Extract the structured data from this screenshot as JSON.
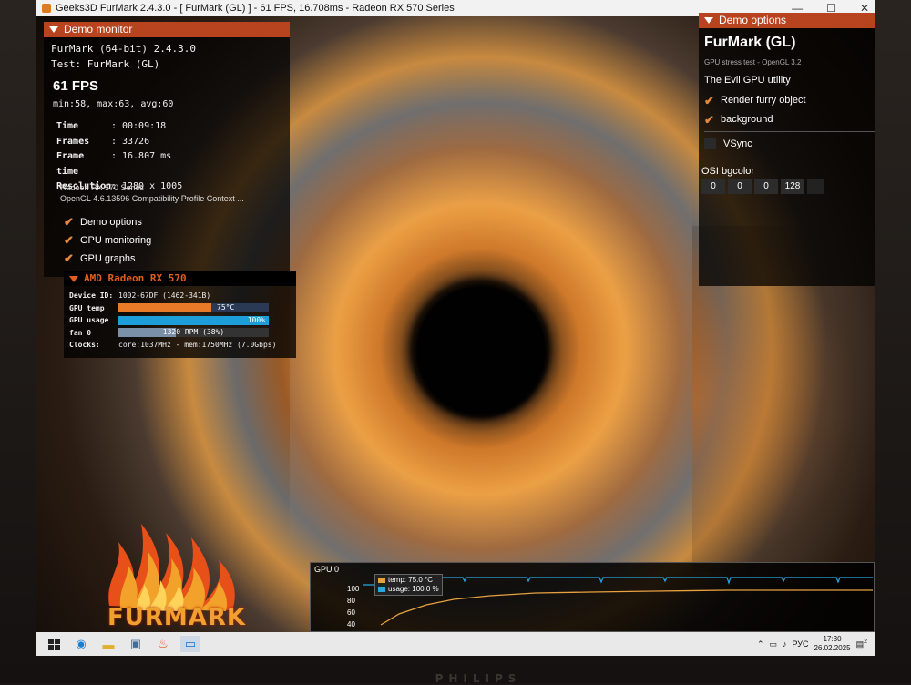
{
  "window": {
    "title": "Geeks3D FurMark 2.4.3.0 - [ FurMark (GL) ] - 61 FPS, 16.708ms - Radeon RX 570 Series",
    "min": "—",
    "max": "☐",
    "close": "✕"
  },
  "demo_monitor": {
    "header": "Demo monitor",
    "app": "FurMark (64-bit) 2.4.3.0",
    "test": "Test: FurMark (GL)",
    "fps": "61 FPS",
    "minmax": "min:58, max:63, avg:60",
    "stats": [
      {
        "key": "Time",
        "value": "00:09:18"
      },
      {
        "key": "Frames",
        "value": "33726"
      },
      {
        "key": "Frame time",
        "value": "16.807 ms"
      },
      {
        "key": "Resolution",
        "value": "1280 x 1005"
      }
    ],
    "gpu_name": "Radeon RX 570 Series",
    "gl_version": "OpenGL 4.6.13596 Compatibility Profile Context ...",
    "options": [
      "Demo options",
      "GPU monitoring",
      "GPU graphs"
    ]
  },
  "amd": {
    "header": "AMD Radeon RX 570",
    "device_id_label": "Device ID:",
    "device_id": "1002-67DF (1462-341B)",
    "temp_label": "GPU temp",
    "temp_value": "75°C",
    "temp_fraction": 0.62,
    "usage_label": "GPU usage",
    "usage_value": "100%",
    "usage_fraction": 1.0,
    "fan_label": "fan 0",
    "fan_value": "1320 RPM (38%)",
    "fan_fraction": 0.38,
    "clocks_label": "Clocks:",
    "clocks_value": "core:1037MHz - mem:1750MHz (7.0Gbps)"
  },
  "logo": {
    "text": "FURMARK"
  },
  "demo_options": {
    "header": "Demo options",
    "title": "FurMark (GL)",
    "subtitle": "GPU stress test - OpenGL 3.2",
    "evil": "The Evil GPU utility",
    "checks": [
      "Render furry object",
      "background"
    ],
    "vsync": "VSync",
    "bgcolor_label": "OSI bgcolor",
    "bgcolor": [
      "0",
      "0",
      "0",
      "128"
    ]
  },
  "graph": {
    "label": "GPU 0",
    "yticks": [
      "100",
      "80",
      "60",
      "40"
    ],
    "legend_temp": "temp: 75.0 °C",
    "legend_usage": "usage: 100.0 %",
    "temp_color": "#e8a040",
    "usage_color": "#29a8e0"
  },
  "taskbar": {
    "lang": "РУС",
    "time": "17:30",
    "date": "26.02.2025",
    "notif_count": "2"
  },
  "brand": "PHILIPS"
}
